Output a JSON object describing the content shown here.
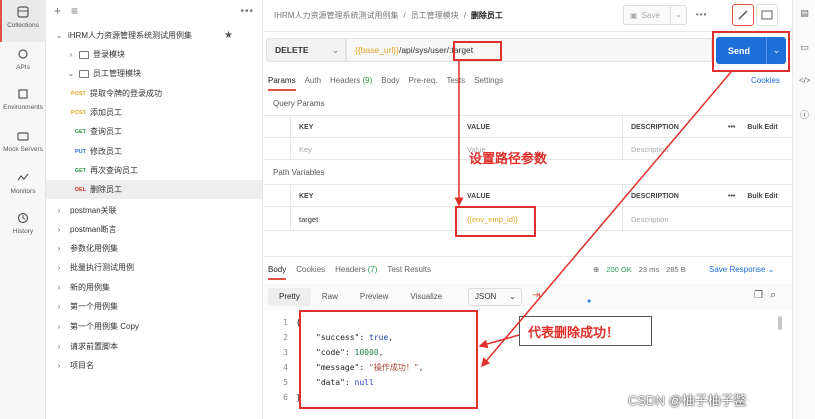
{
  "rail": {
    "items": [
      {
        "label": "Collections",
        "icon": "collections-icon"
      },
      {
        "label": "APIs",
        "icon": "apis-icon"
      },
      {
        "label": "Environments",
        "icon": "environments-icon"
      },
      {
        "label": "Mock Servers",
        "icon": "mock-servers-icon"
      },
      {
        "label": "Monitors",
        "icon": "monitors-icon"
      },
      {
        "label": "History",
        "icon": "history-icon"
      }
    ]
  },
  "sidebar": {
    "collection": "iHRM人力资源管理系统测试用例集",
    "tree": [
      {
        "label": "登录模块"
      },
      {
        "label": "员工管理模块"
      },
      {
        "method": "POST",
        "label": "提取令牌的登录成功"
      },
      {
        "method": "POST",
        "label": "添加员工"
      },
      {
        "method": "GET",
        "label": "查询员工"
      },
      {
        "method": "PUT",
        "label": "修改员工"
      },
      {
        "method": "GET",
        "label": "再次查询员工"
      },
      {
        "method": "DEL",
        "label": "删除员工"
      }
    ],
    "collections": [
      "postman关联",
      "postman断言",
      "参数化用例集",
      "批量执行测试用例",
      "新的用例集",
      "第一个用例集",
      "第一个用例集 Copy",
      "请求前置脚本",
      "项目名"
    ]
  },
  "header": {
    "breadcrumb": [
      "IHRM人力资源管理系统测试用例集",
      "员工管理模块",
      "删除员工"
    ],
    "save_label": "Save"
  },
  "request": {
    "method": "DELETE",
    "url_var": "{{base_url}}",
    "url_path": "/api/sys/user/:target",
    "send_label": "Send",
    "tabs": [
      "Params",
      "Auth",
      "Headers",
      "Body",
      "Pre-req.",
      "Tests",
      "Settings"
    ],
    "headers_count": "(9)",
    "cookies_label": "Cookies"
  },
  "query_params": {
    "title": "Query Params",
    "columns": [
      "KEY",
      "VALUE",
      "DESCRIPTION",
      "Bulk Edit"
    ],
    "placeholder": {
      "key": "Key",
      "value": "Value",
      "description": "Description"
    }
  },
  "path_variables": {
    "title": "Path Variables",
    "columns": [
      "KEY",
      "VALUE",
      "DESCRIPTION",
      "Bulk Edit"
    ],
    "row": {
      "key": "target",
      "value": "{{env_emp_id}}",
      "description": "Description"
    }
  },
  "response": {
    "tabs": [
      "Body",
      "Cookies",
      "Headers",
      "Test Results"
    ],
    "headers_count": "(7)",
    "status": "200 OK",
    "time": "23 ms",
    "size": "285 B",
    "save_label": "Save Response",
    "formats": [
      "Pretty",
      "Raw",
      "Preview",
      "Visualize"
    ],
    "format_select": "JSON",
    "lines": [
      {
        "n": "1",
        "text": "{"
      },
      {
        "n": "2",
        "key": "\"success\"",
        "val": "true",
        "type": "b"
      },
      {
        "n": "3",
        "key": "\"code\"",
        "val": "10000",
        "type": "n"
      },
      {
        "n": "4",
        "key": "\"message\"",
        "val": "\"操作成功！\"",
        "type": "s"
      },
      {
        "n": "5",
        "key": "\"data\"",
        "val": "null",
        "type": "b"
      },
      {
        "n": "6",
        "text": "}"
      }
    ]
  },
  "annotations": {
    "path_note": "设置路径参数",
    "result_note": "代表删除成功！"
  },
  "watermark": "CSDN @柚子柚子鳖",
  "colors": {
    "accent": "#e05243",
    "send": "#1e6fd9",
    "annotation": "#e0302b"
  }
}
